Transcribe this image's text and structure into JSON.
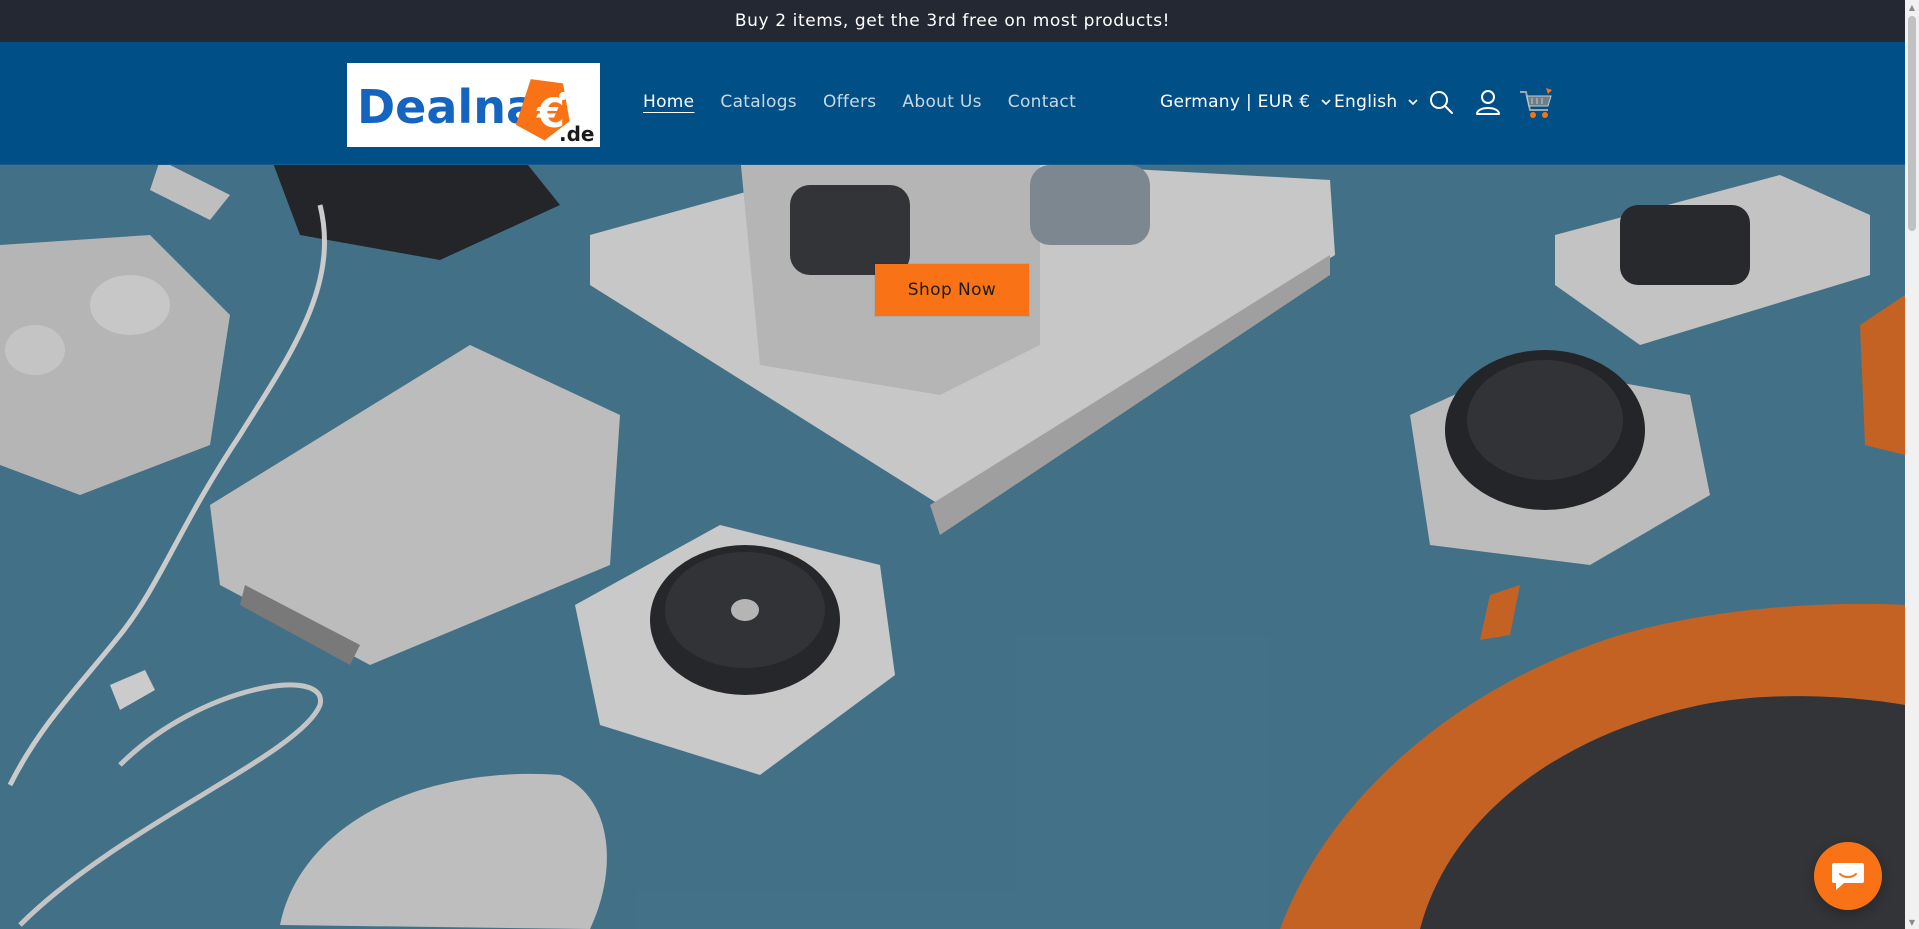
{
  "announcement": {
    "text": "Buy 2 items, get the 3rd free on most products!"
  },
  "header": {
    "logo": {
      "name_text": "Dealna",
      "euro_symbol": "€",
      "tld_text": ".de"
    },
    "nav": [
      {
        "label": "Home",
        "active": true
      },
      {
        "label": "Catalogs",
        "active": false
      },
      {
        "label": "Offers",
        "active": false
      },
      {
        "label": "About Us",
        "active": false
      },
      {
        "label": "Contact",
        "active": false
      }
    ],
    "country_selector": {
      "value": "Germany | EUR €"
    },
    "language_selector": {
      "value": "English"
    },
    "icons": {
      "search": "search-icon",
      "account": "user-icon",
      "cart": "shopping-cart-icon"
    }
  },
  "hero": {
    "cta_label": "Shop Now"
  },
  "chat": {
    "icon": "chat-bubble-icon"
  },
  "colors": {
    "announcement_bg": "#242833",
    "header_bg": "#004f86",
    "accent": "#f97316",
    "hero_bg": "#4c819a"
  }
}
